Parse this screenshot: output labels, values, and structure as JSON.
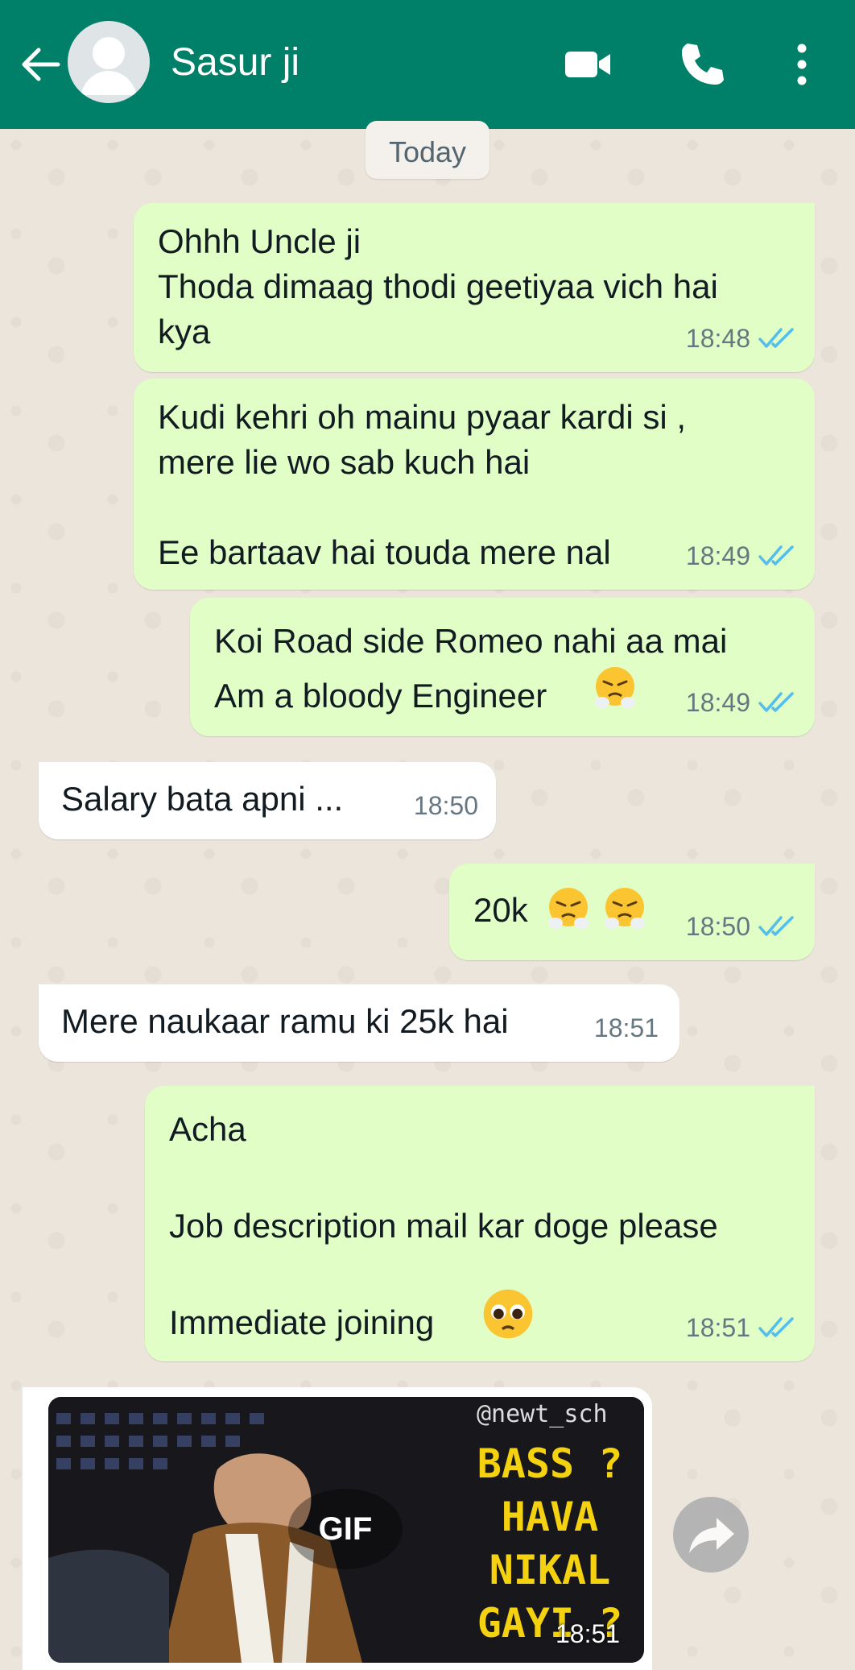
{
  "header": {
    "title": "Sasur ji",
    "back_icon": "arrow-left-icon",
    "video_icon": "video-camera-icon",
    "call_icon": "phone-icon",
    "menu_icon": "more-vertical-icon",
    "bar_color": "#008069"
  },
  "chat": {
    "day_label": "Today",
    "messages": [
      {
        "dir": "out",
        "text": "Ohhh Uncle ji\nThoda dimaag thodi geetiyaa vich hai\nkya",
        "time": "18:48",
        "ticks": "read"
      },
      {
        "dir": "out",
        "text": "Kudi kehri oh mainu pyaar kardi si ,\nmere lie wo sab kuch hai\n\nEe bartaav hai touda mere nal",
        "time": "18:49",
        "ticks": "read"
      },
      {
        "dir": "out",
        "text": "Koi Road side Romeo nahi aa mai\nAm a bloody Engineer",
        "emoji": "face-with-steam-from-nose",
        "time": "18:49",
        "ticks": "read"
      },
      {
        "dir": "in",
        "text": "Salary bata apni ...",
        "time": "18:50"
      },
      {
        "dir": "out",
        "text": "20k",
        "emoji": "face-with-steam-from-nose x2",
        "time": "18:50",
        "ticks": "read"
      },
      {
        "dir": "in",
        "text": "Mere naukaar ramu ki 25k hai",
        "time": "18:51"
      },
      {
        "dir": "out",
        "text": "Acha\n\nJob description mail kar doge please\n\nImmediate joining",
        "emoji": "pleading-face",
        "time": "18:51",
        "ticks": "read"
      }
    ],
    "gif": {
      "badge": "GIF",
      "watermark": "@newt_sch",
      "caption": "BASS ?\nHAVA\nNIKAL\nGAYI ?",
      "time": "18:51",
      "forward_icon": "forward-share-icon"
    }
  },
  "colors": {
    "outgoing_bubble": "#e1fec6",
    "incoming_bubble": "#ffffff",
    "read_tick": "#53bdeb",
    "time_text": "#667781"
  }
}
